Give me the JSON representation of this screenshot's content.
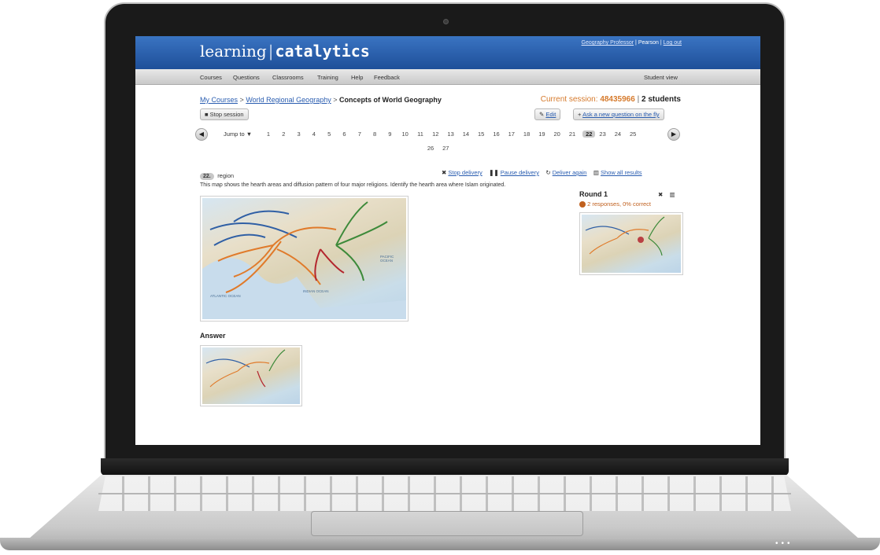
{
  "header": {
    "logo_learning": "learning",
    "logo_sep": "|",
    "logo_catalytics": "catalytics",
    "user_name": "Geography Professor",
    "org": "Pearson",
    "logout": "Log out",
    "sep1": "|",
    "sep2": "|"
  },
  "nav": {
    "courses": "Courses",
    "questions": "Questions",
    "classrooms": "Classrooms",
    "training": "Training",
    "help": "Help",
    "feedback": "Feedback",
    "student_view": "Student view"
  },
  "breadcrumb": {
    "my_courses": "My Courses",
    "arrow1": ">",
    "course": "World Regional Geography",
    "arrow2": ">",
    "current": "Concepts of World Geography"
  },
  "session": {
    "label": "Current session:",
    "code": "48435966",
    "sep": "|",
    "students": "2 students"
  },
  "toolbar": {
    "stop_session": "Stop session",
    "edit": "Edit",
    "ask_new": "Ask a new question on the fly",
    "jump_to": "Jump to"
  },
  "pager": {
    "pages": [
      "1",
      "2",
      "3",
      "4",
      "5",
      "6",
      "7",
      "8",
      "9",
      "10",
      "11",
      "12",
      "13",
      "14",
      "15",
      "16",
      "17",
      "18",
      "19",
      "20",
      "21",
      "22",
      "23",
      "24",
      "25",
      "26",
      "27"
    ],
    "current": "22"
  },
  "question": {
    "number": "22.",
    "type": "region",
    "stop_delivery": "Stop delivery",
    "pause_delivery": "Pause delivery",
    "deliver_again": "Deliver again",
    "show_all": "Show all results",
    "prompt": "This map shows the hearth areas and diffusion pattern of four major religions. Identify the hearth area where Islam originated.",
    "answer_heading": "Answer"
  },
  "round": {
    "title": "Round 1",
    "responses": "2 responses, 0% correct",
    "dot_color": "#c0601e"
  },
  "map_labels": {
    "atlantic": "ATLANTIC OCEAN",
    "indian": "INDIAN OCEAN",
    "pacific": "PACIFIC OCEAN"
  },
  "colors": {
    "banner": "#2a5fae",
    "link": "#2a5db0",
    "session": "#d67a2c",
    "route_orange": "#e07a2a",
    "route_blue": "#2f5fa5",
    "route_green": "#3d8a3a",
    "route_red": "#b3262e"
  }
}
